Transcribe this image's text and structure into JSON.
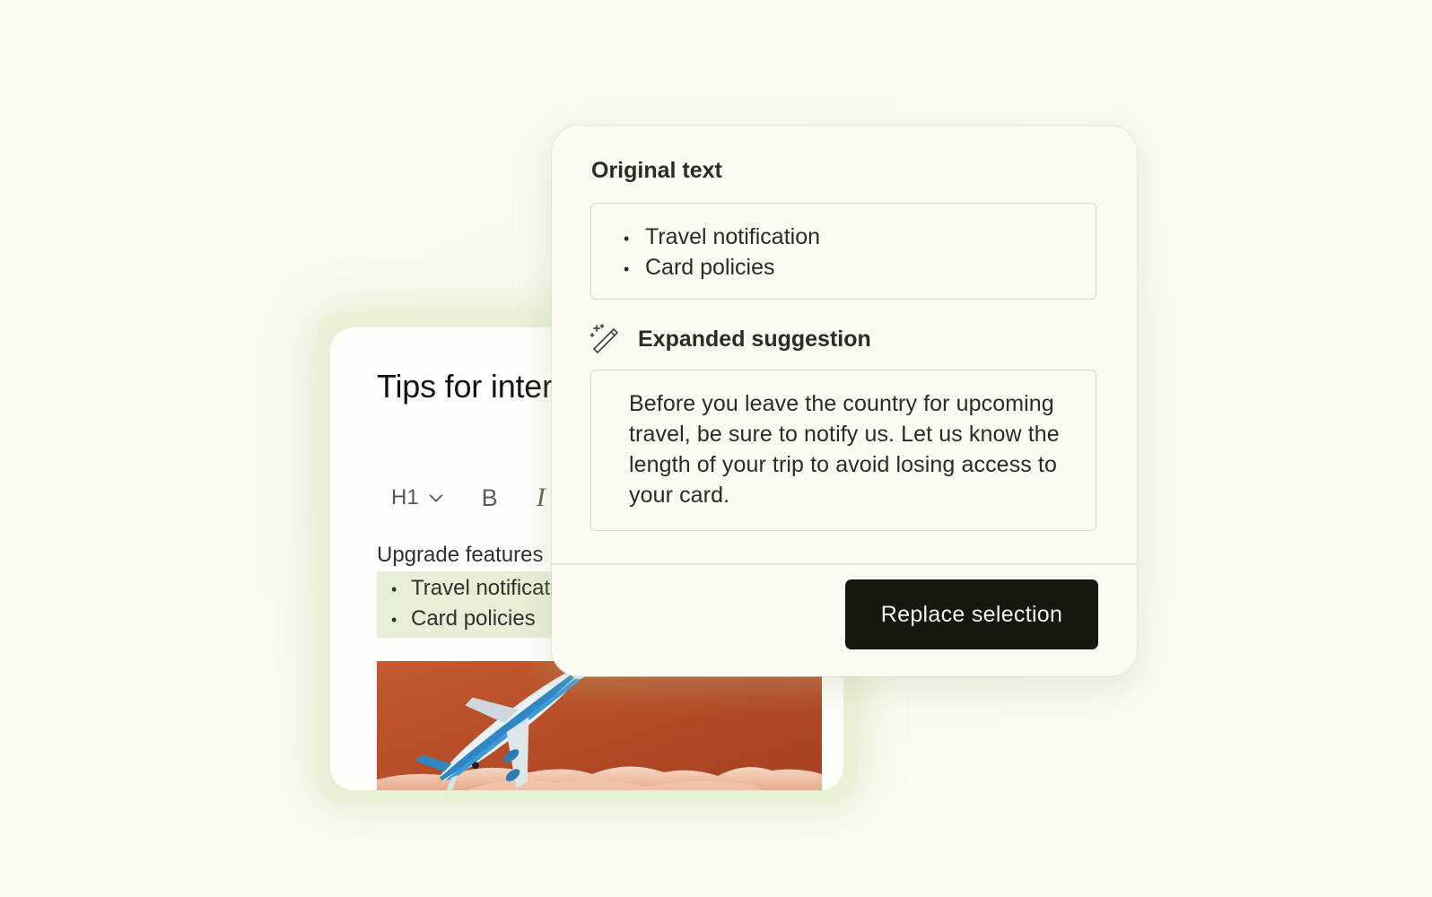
{
  "editor": {
    "title": "Tips for international card use",
    "toolbar": {
      "heading_select_label": "H1",
      "bold_label": "B",
      "italic_label": "I"
    },
    "body_lead": "Upgrade features",
    "selected_list": [
      "Travel notification",
      "Card policies"
    ],
    "image_icon": "airplane-illustration"
  },
  "popover": {
    "original_title": "Original text",
    "original_items": [
      "Travel notification",
      "Card policies"
    ],
    "suggestion_title": "Expanded suggestion",
    "suggestion_icon": "magic-wand-icon",
    "suggestion_text": "Before you leave the country for upcoming travel, be sure to notify us. Let us know the length of your trip to avoid losing access to your card.",
    "primary_button_label": "Replace selection"
  },
  "colors": {
    "background": "#fbfbf2",
    "highlight": "#e7efd7",
    "button": "#17160f",
    "image_sky": "#b8502a"
  }
}
